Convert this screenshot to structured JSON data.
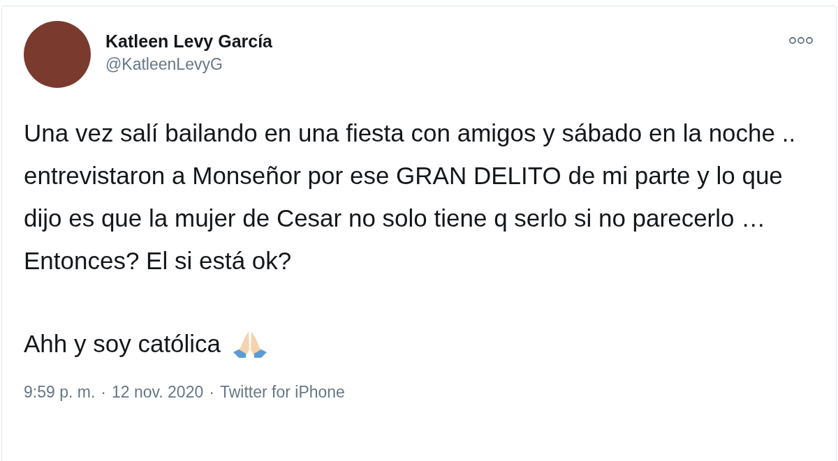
{
  "author": {
    "name": "Katleen Levy García",
    "handle": "@KatleenLevyG"
  },
  "paragraphs": [
    "Una vez salí bailando en una fiesta con amigos y sábado en la noche .. entrevistaron a Monseñor por ese GRAN DELITO de mi parte y lo que dijo es que la mujer de Cesar no solo tiene q serlo si no parecerlo … Entonces? El si está ok?",
    "Ahh y soy católica"
  ],
  "footer": {
    "time": "9:59 p. m.",
    "separator": "·",
    "date": "12 nov. 2020",
    "source": "Twitter for iPhone"
  }
}
